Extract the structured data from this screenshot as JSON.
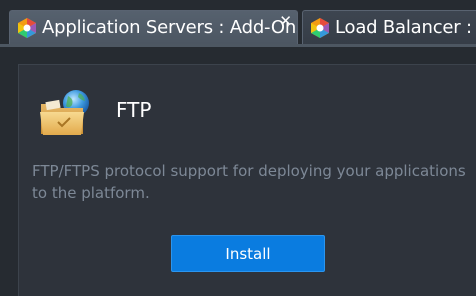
{
  "tabs": [
    {
      "label": "Application Servers : Add-Ons",
      "active": true,
      "icon": "jelastic-logo-icon",
      "closable": true
    },
    {
      "label": "Load Balancer : Ad",
      "active": false,
      "icon": "jelastic-logo-icon",
      "closable": false
    }
  ],
  "addon": {
    "title": "FTP",
    "icon": "ftp-folder-globe-icon",
    "description": "FTP/FTPS protocol support for deploying your applications to the platform.",
    "install_label": "Install"
  },
  "colors": {
    "background": "#262b31",
    "panel": "#2e333b",
    "tab_active": "#56616e",
    "accent_button": "#0a7ce0",
    "description_text": "#7d8896"
  }
}
